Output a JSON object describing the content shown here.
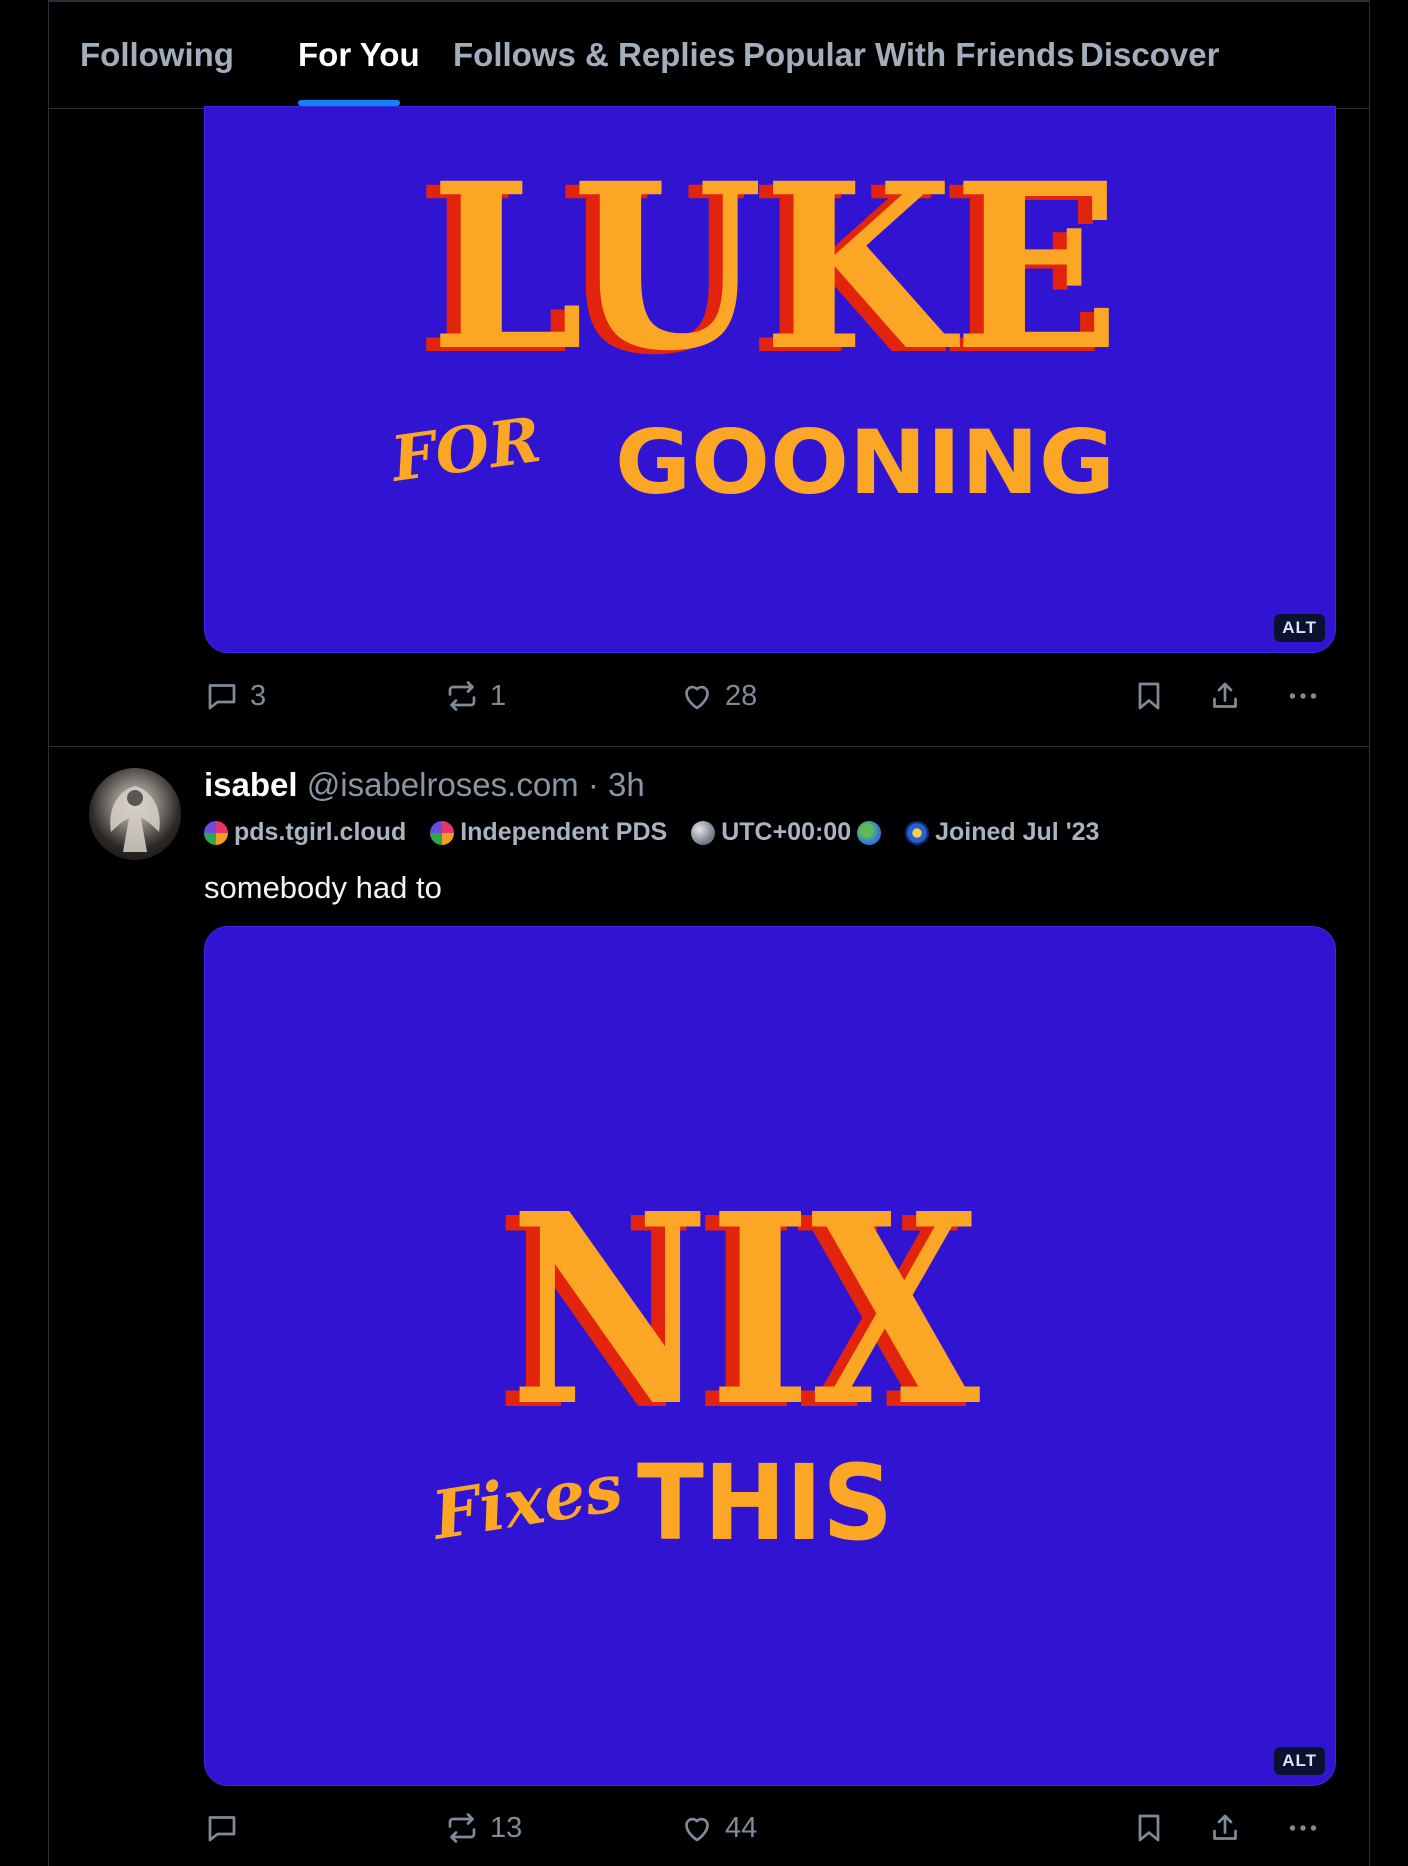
{
  "tabs": [
    {
      "label": "Following",
      "active": false
    },
    {
      "label": "For You",
      "active": true
    },
    {
      "label": "Follows & Replies",
      "active": false
    },
    {
      "label": "Popular With Friends",
      "active": false
    },
    {
      "label": "Discover",
      "active": false
    }
  ],
  "post1": {
    "image": {
      "line1": "LUKE",
      "line2_script": "FOR",
      "line2": "GOONING",
      "alt_badge": "ALT"
    },
    "actions": {
      "replies": "3",
      "reposts": "1",
      "likes": "28"
    }
  },
  "post2": {
    "author_name": "isabel",
    "author_handle": "@isabelroses.com",
    "separator": "·",
    "time": "3h",
    "badges": [
      {
        "label": "pds.tgirl.cloud",
        "icon": "pds-icon"
      },
      {
        "label": "Independent PDS",
        "icon": "pds-icon"
      },
      {
        "label": "UTC+00:00",
        "icon": "globe-icon",
        "suffix_icon": "globe-icon"
      },
      {
        "label": "Joined Jul '23",
        "icon": "sunburst-icon"
      }
    ],
    "text": "somebody had to",
    "image": {
      "line1": "NIX",
      "line2_script": "Fixes",
      "line2": "THIS",
      "alt_badge": "ALT"
    },
    "actions": {
      "replies": "",
      "reposts": "13",
      "likes": "44"
    }
  },
  "colors": {
    "background": "#000000",
    "image_bg": "#3014d2",
    "title_orange": "#fba624",
    "title_shadow": "#e3240c",
    "accent_blue": "#1083fe"
  }
}
